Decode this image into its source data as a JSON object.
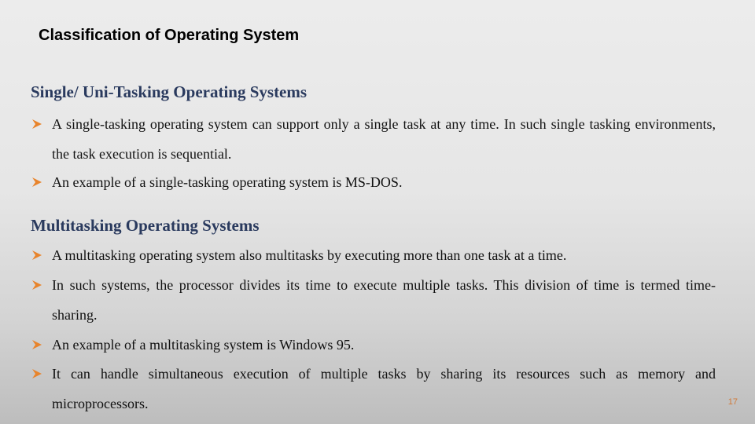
{
  "slide": {
    "title": "Classification of Operating System",
    "page_number": "17",
    "colors": {
      "heading": "#2a3a5e",
      "bullet_arrow": "#e8842c",
      "page_number": "#d07a3a"
    }
  },
  "sections": [
    {
      "heading": "Single/ Uni-Tasking Operating Systems",
      "bullets": [
        "A single-tasking operating system can support only a single task at any time. In such single tasking environments, the task execution is sequential.",
        "An example of a single-tasking operating system is MS-DOS."
      ]
    },
    {
      "heading": "Multitasking Operating Systems",
      "bullets": [
        "A multitasking operating system also multitasks by executing more than one task at a time.",
        "In such systems, the processor divides its time to execute multiple tasks. This division of time is termed time-sharing.",
        "An example of a multitasking system is Windows 95.",
        "It can handle simultaneous execution of multiple tasks by sharing its resources such as memory and microprocessors."
      ]
    }
  ],
  "icons": {
    "bullet": "arrow-bullet-icon"
  }
}
